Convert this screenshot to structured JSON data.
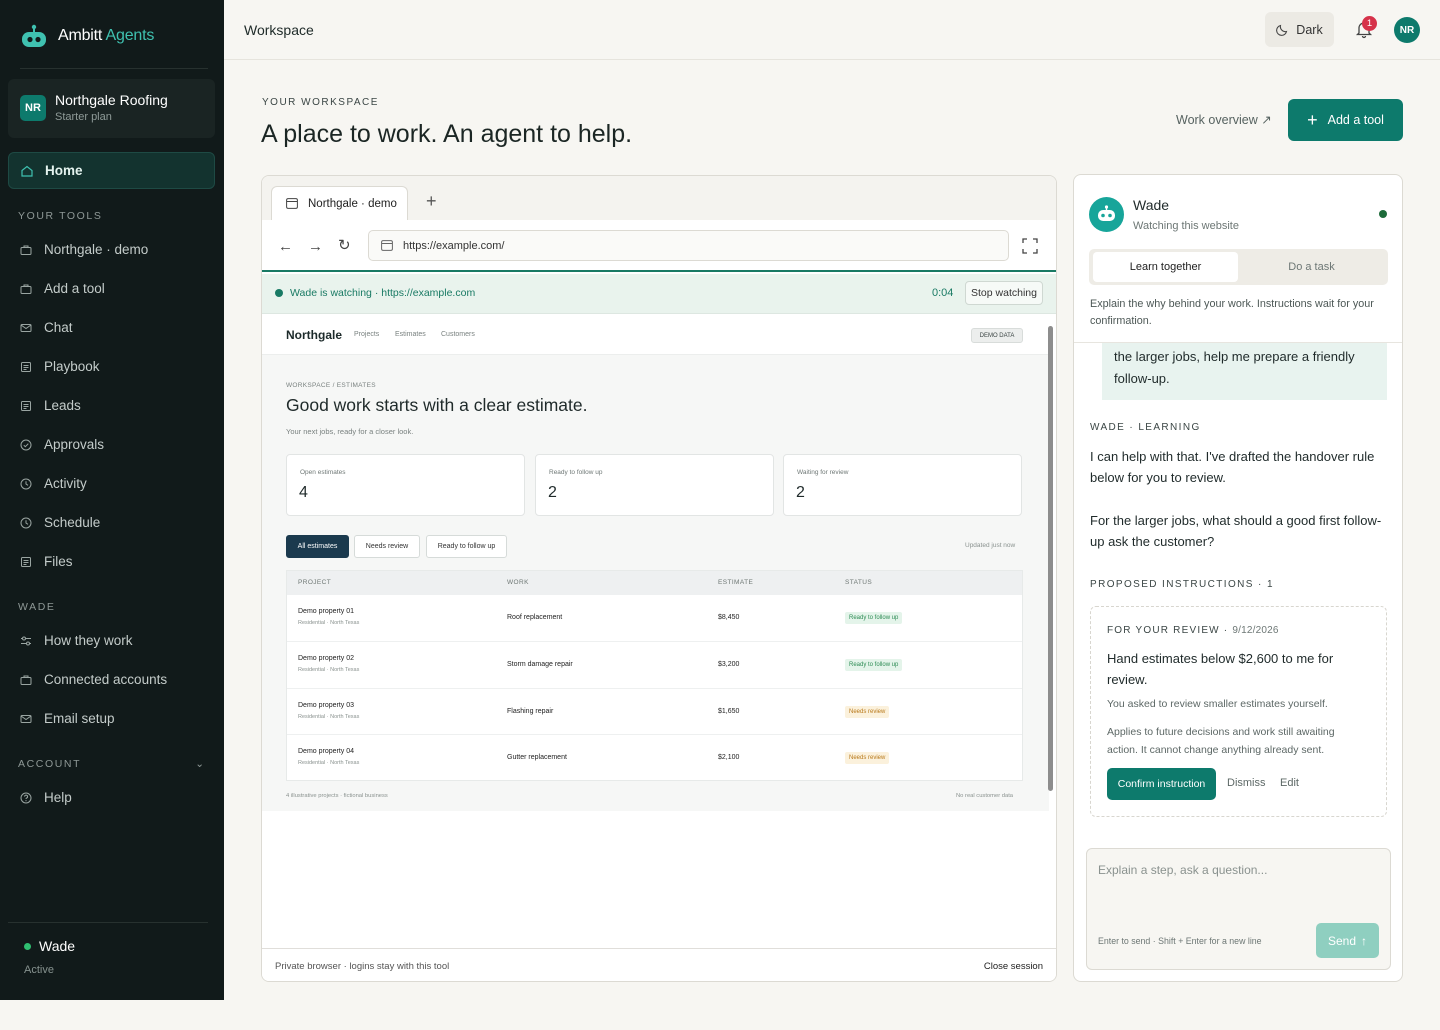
{
  "brand": {
    "name_a": "Ambitt",
    "name_b": "Agents"
  },
  "org": {
    "initials": "NR",
    "name": "Northgale Roofing",
    "plan": "Starter plan"
  },
  "nav": {
    "home": "Home",
    "your_tools_header": "YOUR TOOLS",
    "tools": [
      "Northgale · demo",
      "Add a tool",
      "Chat",
      "Playbook",
      "Leads",
      "Approvals",
      "Activity",
      "Schedule",
      "Files"
    ],
    "wade_header": "WADE",
    "wade_items": [
      "How they work",
      "Connected accounts",
      "Email setup"
    ],
    "account_header": "ACCOUNT",
    "account_items": [
      "Help"
    ]
  },
  "agent_footer": {
    "name": "Wade",
    "status": "Active"
  },
  "topbar": {
    "title": "Workspace",
    "theme_label": "Dark",
    "notif_count": "1",
    "user_initials": "NR"
  },
  "page": {
    "eyebrow": "YOUR WORKSPACE",
    "title": "A place to work. An agent to help.",
    "overview_link": "Work overview ↗",
    "add_tool": "Add a tool"
  },
  "browser": {
    "tab_label": "Northgale · demo",
    "url": "https://example.com/",
    "watch_text": "Wade is watching · https://example.com",
    "timer": "0:04",
    "stop_label": "Stop watching",
    "footer_left": "Private browser · logins stay with this tool",
    "footer_right": "Close session"
  },
  "site": {
    "logo": "Northgale",
    "nav_links": [
      "Projects",
      "Estimates",
      "Customers"
    ],
    "demo_tag": "DEMO DATA",
    "crumb": "WORKSPACE / ESTIMATES",
    "headline": "Good work starts with a clear estimate.",
    "subhead": "Your next jobs, ready for a closer look.",
    "kpis": [
      {
        "label": "Open estimates",
        "value": "4"
      },
      {
        "label": "Ready to follow up",
        "value": "2"
      },
      {
        "label": "Waiting for review",
        "value": "2"
      }
    ],
    "filters": [
      "All estimates",
      "Needs review",
      "Ready to follow up"
    ],
    "updated": "Updated just now",
    "columns": [
      "PROJECT",
      "WORK",
      "ESTIMATE",
      "STATUS"
    ],
    "rows": [
      {
        "project": "Demo property 01",
        "sub": "Residential · North Texas",
        "work": "Roof replacement",
        "estimate": "$8,450",
        "status": "Ready to follow up"
      },
      {
        "project": "Demo property 02",
        "sub": "Residential · North Texas",
        "work": "Storm damage repair",
        "estimate": "$3,200",
        "status": "Ready to follow up"
      },
      {
        "project": "Demo property 03",
        "sub": "Residential · North Texas",
        "work": "Flashing repair",
        "estimate": "$1,650",
        "status": "Needs review"
      },
      {
        "project": "Demo property 04",
        "sub": "Residential · North Texas",
        "work": "Gutter replacement",
        "estimate": "$2,100",
        "status": "Needs review"
      }
    ],
    "foot_left": "4 illustrative projects · fictional business",
    "foot_right": "No real customer data"
  },
  "panel": {
    "agent": "Wade",
    "agent_status": "Watching this website",
    "mode_a": "Learn together",
    "mode_b": "Do a task",
    "explain": "Explain the why behind your work. Instructions wait for your confirmation.",
    "user_msg": "the larger jobs, help me prepare a friendly follow-up.",
    "learning_label": "WADE · LEARNING",
    "reply_1": "I can help with that. I've drafted the handover rule below for you to review.",
    "reply_2": "For the larger jobs, what should a good first follow-up ask the customer?",
    "proposed_label": "PROPOSED INSTRUCTIONS · 1",
    "card": {
      "review_label": "FOR YOUR REVIEW ·",
      "review_date": "9/12/2026",
      "rule": "Hand estimates below $2,600 to me for review.",
      "note_1": "You asked to review smaller estimates yourself.",
      "note_2": "Applies to future decisions and work still awaiting action. It cannot change anything already sent.",
      "confirm": "Confirm instruction",
      "dismiss": "Dismiss",
      "edit": "Edit"
    },
    "composer_placeholder": "Explain a step, ask a question...",
    "composer_hint": "Enter to send · Shift + Enter for a new line",
    "send": "Send"
  },
  "colors": {
    "accent": "#0d7a6c",
    "sidebar": "#111a1a",
    "ready": "#2d8c54",
    "review": "#b8791a"
  }
}
